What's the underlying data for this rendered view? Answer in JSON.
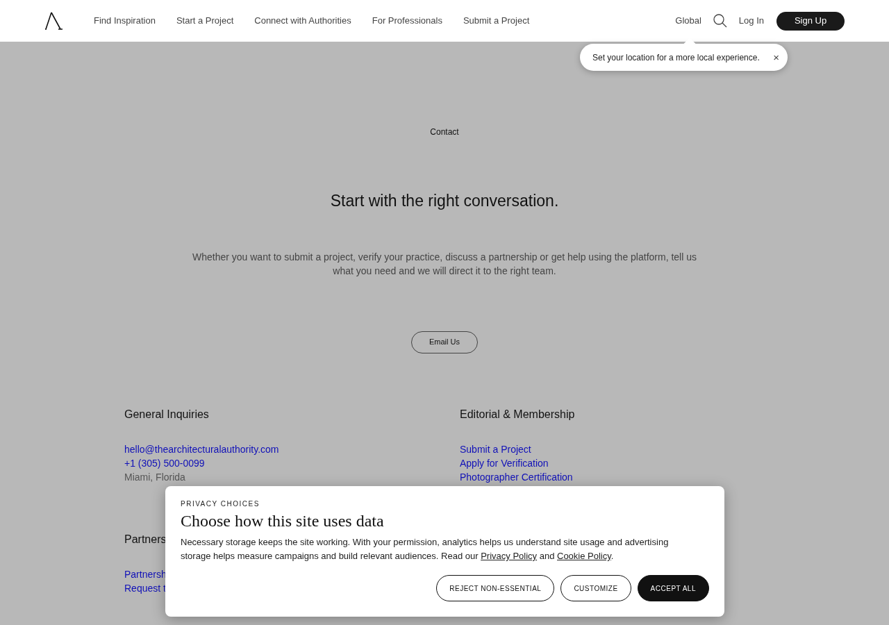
{
  "header": {
    "nav": [
      "Find Inspiration",
      "Start a Project",
      "Connect with Authorities",
      "For Professionals",
      "Submit a Project"
    ],
    "region": "Global",
    "login": "Log In",
    "signup": "Sign Up"
  },
  "tooltip": {
    "text": "Set your location for a more local experience.",
    "close": "×"
  },
  "contact": {
    "eyebrow": "Contact",
    "title": "Start with the right conversation.",
    "body": "Whether you want to submit a project, verify your practice, discuss a partnership or get help using the platform, tell us what you need and we will direct it to the right team.",
    "button": "Email Us"
  },
  "sections": [
    {
      "title": "General Inquiries",
      "items": [
        {
          "text": "hello@thearchitecturalauthority.com",
          "kind": "link"
        },
        {
          "text": "+1 (305) 500-0099",
          "kind": "link"
        },
        {
          "text": "Miami, Florida",
          "kind": "text"
        }
      ]
    },
    {
      "title": "Editorial & Membership",
      "items": [
        {
          "text": "Submit a Project",
          "kind": "link"
        },
        {
          "text": "Apply for Verification",
          "kind": "link"
        },
        {
          "text": "Photographer Certification",
          "kind": "link"
        }
      ]
    },
    {
      "title": "Partners",
      "items": [
        {
          "text": "Partnersh",
          "kind": "link"
        },
        {
          "text": "Request t",
          "kind": "link"
        }
      ]
    }
  ],
  "privacy": {
    "eyebrow": "PRIVACY CHOICES",
    "title": "Choose how this site uses data",
    "body": [
      {
        "text": "Necessary storage keeps the site working. With your permission, analytics helps us understand site usage and advertising storage helps measure campaigns and build relevant audiences. Read our ",
        "kind": "text"
      },
      {
        "text": "Privacy Policy",
        "kind": "link"
      },
      {
        "text": " and ",
        "kind": "text"
      },
      {
        "text": "Cookie Policy",
        "kind": "link"
      },
      {
        "text": ".",
        "kind": "text"
      }
    ],
    "buttons": [
      {
        "label": "REJECT NON-ESSENTIAL",
        "kind": "outline"
      },
      {
        "label": "CUSTOMIZE",
        "kind": "outline"
      },
      {
        "label": "ACCEPT ALL",
        "kind": "primary"
      }
    ]
  }
}
